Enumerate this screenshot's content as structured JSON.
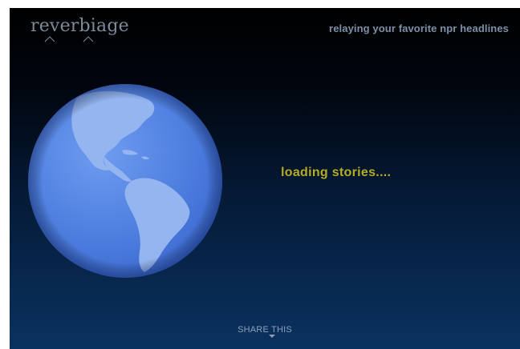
{
  "header": {
    "logo_text": "reverbiage",
    "tagline": "relaying your favorite npr headlines"
  },
  "main": {
    "globe_icon": "globe-americas-icon",
    "status_text": "loading stories...."
  },
  "footer": {
    "share_label": "SHARE THIS",
    "share_icon": "triangle-down-icon"
  },
  "colors": {
    "background_top": "#000000",
    "background_bottom": "#0a3260",
    "status_text": "#b3ad25",
    "ocean": "#5a8ae8",
    "land": "#93b4ef"
  }
}
